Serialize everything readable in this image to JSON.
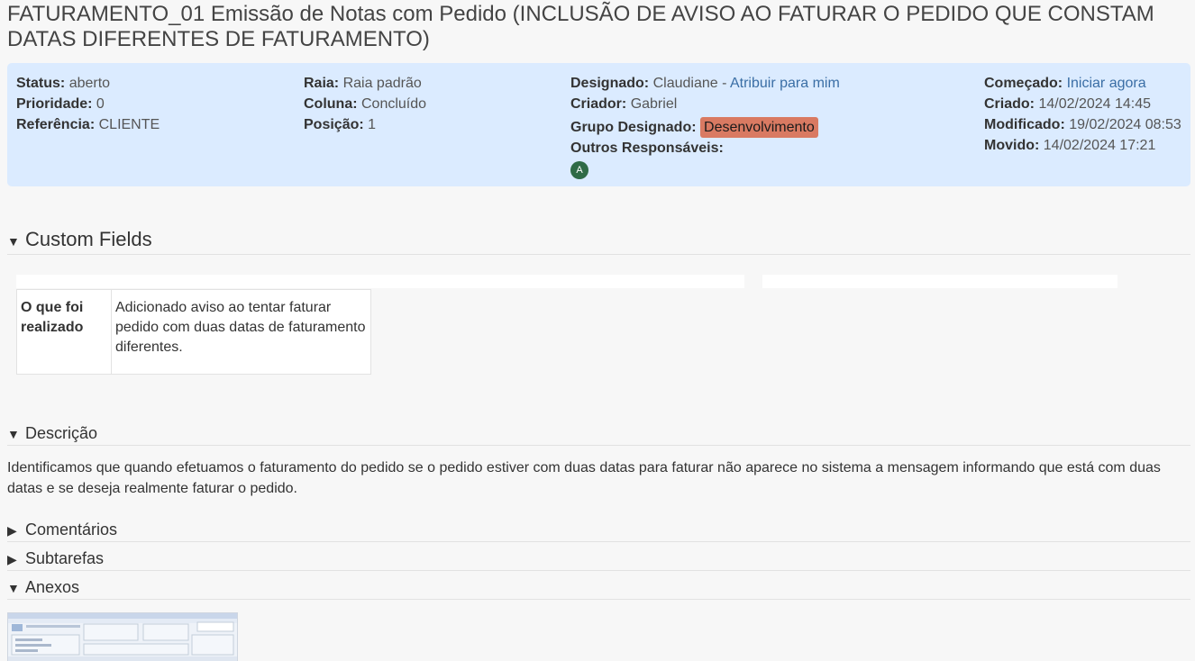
{
  "task": {
    "title": "FATURAMENTO_01 Emissão de Notas com Pedido (INCLUSÃO DE AVISO AO FATURAR O PEDIDO QUE CONSTAM DATAS DIFERENTES DE FATURAMENTO)"
  },
  "summary": {
    "status_label": "Status:",
    "status": "aberto",
    "priority_label": "Prioridade:",
    "priority": "0",
    "reference_label": "Referência:",
    "reference": "CLIENTE",
    "swimlane_label": "Raia:",
    "swimlane": "Raia padrão",
    "column_label": "Coluna:",
    "column": "Concluído",
    "position_label": "Posição:",
    "position": "1",
    "assignee_label": "Designado:",
    "assignee": "Claudiane -",
    "assign_to_me": "Atribuir para mim",
    "creator_label": "Criador:",
    "creator": "Gabriel",
    "group_label": "Grupo Designado:",
    "group": "Desenvolvimento",
    "others_label": "Outros Responsáveis:",
    "other_avatar": "A",
    "started_label": "Começado:",
    "start_now": "Iniciar agora",
    "created_label": "Criado:",
    "created": "14/02/2024 14:45",
    "modified_label": "Modificado:",
    "modified": "19/02/2024 08:53",
    "moved_label": "Movido:",
    "moved": "14/02/2024 17:21"
  },
  "custom_fields": {
    "heading": "Custom Fields",
    "rows": [
      {
        "key": "O que foi realizado",
        "value": "Adicionado aviso ao tentar faturar pedido com duas datas de faturamento diferentes."
      }
    ]
  },
  "description": {
    "heading": "Descrição",
    "text": "Identificamos que quando efetuamos o faturamento do pedido se o pedido estiver com duas datas para faturar não aparece no sistema a mensagem informando que está com duas datas e se deseja realmente faturar o pedido."
  },
  "sections": {
    "comments": "Comentários",
    "subtasks": "Subtarefas",
    "attachments": "Anexos"
  },
  "colors": {
    "summary_bg": "#dbebff",
    "link": "#3a6ea5",
    "group_badge": "#d97a62",
    "avatar": "#2f6b46"
  }
}
